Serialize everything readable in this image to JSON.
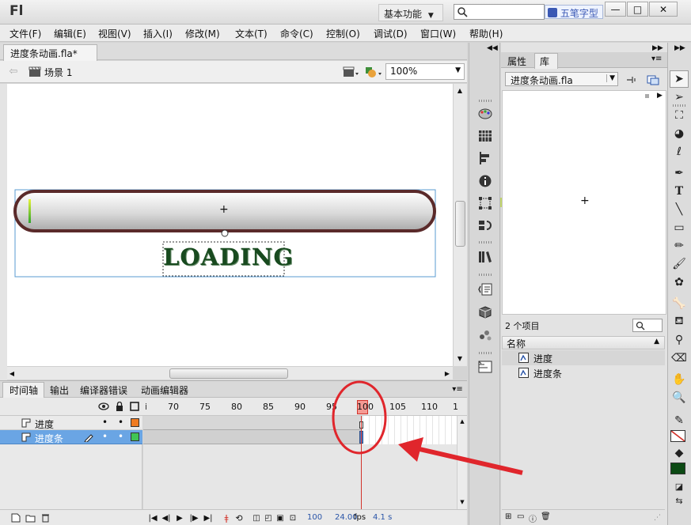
{
  "app": {
    "logo": "Fl",
    "workspace_label": "基本功能",
    "search_hint": "五笔字型",
    "min_glyph": "—",
    "max_glyph": "□",
    "close_glyph": "✕"
  },
  "menu": [
    "文件(F)",
    "编辑(E)",
    "视图(V)",
    "插入(I)",
    "修改(M)",
    "文本(T)",
    "命令(C)",
    "控制(O)",
    "调试(D)",
    "窗口(W)",
    "帮助(H)"
  ],
  "document": {
    "tab_title": "进度条动画.fla*",
    "tab_close": "×",
    "scene_label": "场景 1",
    "zoom": "100%"
  },
  "stage": {
    "loading_text": "LOADING",
    "crosshair": "+"
  },
  "timeline": {
    "tabs": [
      "时间轴",
      "输出",
      "编译器错误",
      "动画编辑器"
    ],
    "ruler": [
      "70",
      "75",
      "80",
      "85",
      "90",
      "95",
      "100",
      "105",
      "110"
    ],
    "ruler_partial_right": "1",
    "ruler_partial_left": "i",
    "highlighted_frame": 100,
    "layers": [
      {
        "name": "进度",
        "eye": "•",
        "lock": "•",
        "color": "#ef7b22",
        "selected": false
      },
      {
        "name": "进度条",
        "eye": "•",
        "lock": "•",
        "color": "#40c455",
        "selected": true
      }
    ],
    "status": {
      "frame": "100",
      "fps": "24.00",
      "fps_unit": "fps",
      "time": "4.1 s"
    }
  },
  "library": {
    "tabs": [
      "属性",
      "库"
    ],
    "active_tab": "库",
    "file_dropdown": "进度条动画.fla",
    "item_count": "2 个项目",
    "column_header": "名称",
    "items": [
      "进度",
      "进度条"
    ],
    "crosshair": "+"
  },
  "colors": {
    "accent_red": "#e0262c",
    "selected_layer": "#6aa5e4",
    "stroke_fill_color": "#0c4a14"
  }
}
